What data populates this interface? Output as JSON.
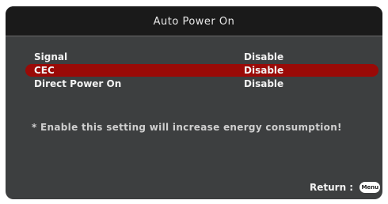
{
  "window": {
    "title": "Auto Power On"
  },
  "settings": [
    {
      "label": "Signal",
      "value": "Disable",
      "selected": false
    },
    {
      "label": "CEC",
      "value": "Disable",
      "selected": true
    },
    {
      "label": "Direct Power On",
      "value": "Disable",
      "selected": false
    }
  ],
  "note": "* Enable this setting will increase energy consumption!",
  "footer": {
    "return_label": "Return :",
    "menu_button": "Menu"
  },
  "colors": {
    "panel": "#3d3f40",
    "titlebar": "#1a1a1a",
    "selection": "#9a0a07",
    "text": "#f2f2f2"
  }
}
